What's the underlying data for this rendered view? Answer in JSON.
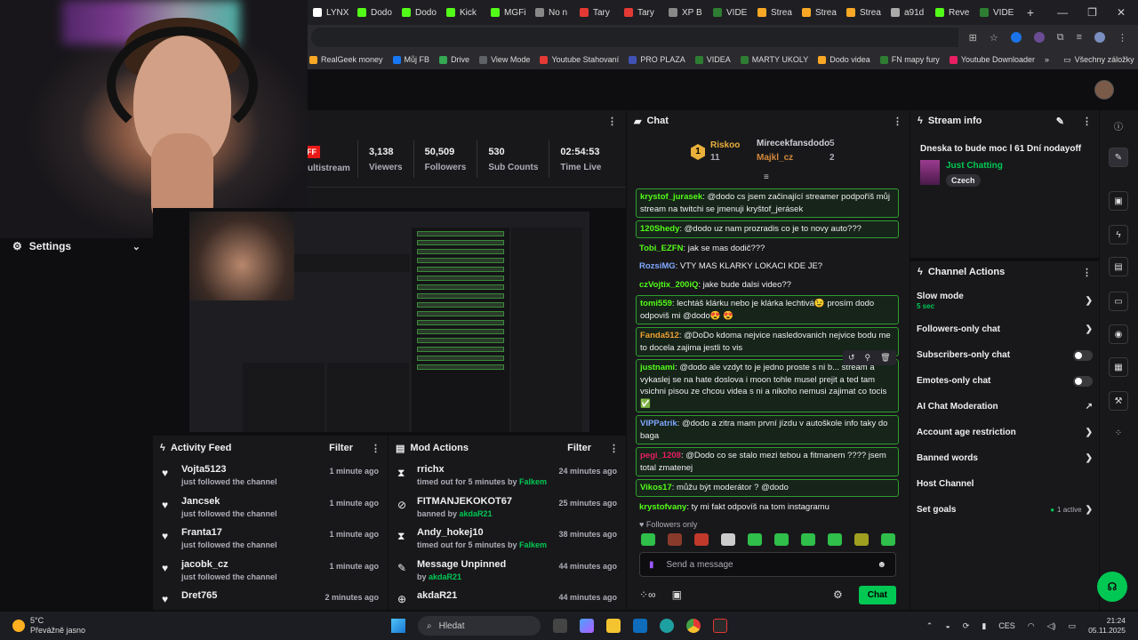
{
  "browser": {
    "tabs": [
      {
        "label": "LYNX",
        "color": "#ffffff"
      },
      {
        "label": "Dodo",
        "color": "#53fc18"
      },
      {
        "label": "Dodo",
        "color": "#53fc18"
      },
      {
        "label": "Kick",
        "color": "#53fc18"
      },
      {
        "label": "MGFi",
        "color": "#53fc18"
      },
      {
        "label": "No n",
        "color": "#888888"
      },
      {
        "label": "Tary",
        "color": "#e53935"
      },
      {
        "label": "Tary",
        "color": "#e53935"
      },
      {
        "label": "XP B",
        "color": "#888888"
      },
      {
        "label": "VIDE",
        "color": "#2e7d32"
      },
      {
        "label": "Strea",
        "color": "#f9a825"
      },
      {
        "label": "Strea",
        "color": "#f9a825"
      },
      {
        "label": "Strea",
        "color": "#f9a825"
      },
      {
        "label": "a91d",
        "color": "#aaaaaa"
      },
      {
        "label": "Reve",
        "color": "#53fc18"
      },
      {
        "label": "VIDE",
        "color": "#2e7d32"
      }
    ],
    "new_tab": "+",
    "bookmarks": [
      {
        "label": "RealGeek money",
        "color": "#f9a825"
      },
      {
        "label": "Můj FB",
        "color": "#1877f2"
      },
      {
        "label": "Drive",
        "color": "#34a853"
      },
      {
        "label": "View Mode",
        "color": "#5f6368"
      },
      {
        "label": "Youtube Stahovaní",
        "color": "#e53935"
      },
      {
        "label": "PRO PLAZA",
        "color": "#3f51b5"
      },
      {
        "label": "VIDEA",
        "color": "#2e7d32"
      },
      {
        "label": "MARTY UKOLY",
        "color": "#2e7d32"
      },
      {
        "label": "Dodo videa",
        "color": "#f9a825"
      },
      {
        "label": "FN mapy fury",
        "color": "#2e7d32"
      },
      {
        "label": "Youtube Downloader",
        "color": "#e91e63"
      }
    ],
    "more_bookmarks": "»",
    "all_bookmarks": "Všechny záložky"
  },
  "webcam_settings": {
    "label": "Settings"
  },
  "stats": {
    "off_badge": "OFF",
    "multistream": "ultistream",
    "items": [
      {
        "value": "3,138",
        "label": "Viewers"
      },
      {
        "value": "50,509",
        "label": "Followers"
      },
      {
        "value": "530",
        "label": "Sub Counts"
      },
      {
        "value": "02:54:53",
        "label": "Time Live"
      }
    ]
  },
  "activity_feed": {
    "title": "Activity Feed",
    "filter": "Filter",
    "items": [
      {
        "name": "Vojta5123",
        "sub": "just followed the channel",
        "time": "1 minute ago"
      },
      {
        "name": "Jancsek",
        "sub": "just followed the channel",
        "time": "1 minute ago"
      },
      {
        "name": "Franta17",
        "sub": "just followed the channel",
        "time": "1 minute ago"
      },
      {
        "name": "jacobk_cz",
        "sub": "just followed the channel",
        "time": "1 minute ago"
      },
      {
        "name": "Dret765",
        "sub": "",
        "time": "2 minutes ago"
      }
    ]
  },
  "mod_actions": {
    "title": "Mod Actions",
    "filter": "Filter",
    "items": [
      {
        "icon": "⧗",
        "name": "rrichx",
        "sub": "timed out for 5 minutes by",
        "by": "Falkem",
        "time": "24 minutes ago"
      },
      {
        "icon": "⊘",
        "name": "FITMANJEKOKOT67",
        "sub": "banned by",
        "by": "akdaR21",
        "time": "25 minutes ago"
      },
      {
        "icon": "⧗",
        "name": "Andy_hokej10",
        "sub": "timed out for 5 minutes by",
        "by": "Falkem",
        "time": "38 minutes ago"
      },
      {
        "icon": "✎",
        "name": "Message Unpinned",
        "sub": "by",
        "by": "akdaR21",
        "time": "44 minutes ago"
      },
      {
        "icon": "⊕",
        "name": "akdaR21",
        "sub": "",
        "by": "",
        "time": "44 minutes ago"
      }
    ]
  },
  "chat": {
    "title": "Chat",
    "leaderboard": {
      "rank1_badge": "1",
      "rank1_name": "Riskoo",
      "rank1_count": "11",
      "rank2_name": "Mirecekfansdodo",
      "rank2_count": "5",
      "rank3_name": "Majkl_cz",
      "rank3_count": "2"
    },
    "messages": [
      {
        "user": "krystof_jurasek",
        "color": "#53fc18",
        "text": "@dodo cs jsem začinající streamer podpoříš můj stream na twitchi se jmenuji kryštof_jerásek",
        "highlight": true
      },
      {
        "user": "120Shedy",
        "color": "#53fc18",
        "text": "@dodo uz nam prozradis co je to novy auto???",
        "highlight": true
      },
      {
        "user": "Tobi_EZFN",
        "color": "#53fc18",
        "text": "jak se mas dodič???",
        "highlight": false
      },
      {
        "user": "RozsiMG",
        "color": "#7fa8ff",
        "text": "VTY MAS KLARKY LOKACI KDE JE?",
        "highlight": false
      },
      {
        "user": "czVojtix_200iQ",
        "color": "#53fc18",
        "text": "jake bude dalsi video??",
        "highlight": false
      },
      {
        "user": "tomi559",
        "color": "#53fc18",
        "text": "lechtáš klárku nebo je klárka lechtivá😉 prosím dodo odpoviš mi @dodo😍 😍",
        "highlight": true
      },
      {
        "user": "Fanda512",
        "color": "#f0a030",
        "text": "@DoDo kdoma nejvice nasledovanich nejvice bodu me to docela zajima jestli to vis",
        "highlight": true
      },
      {
        "user": "justnami",
        "color": "#53fc18",
        "text": "@dodo ale vzdyt to je jedno proste s ni b... stream a vykaslej se na hate doslova i moon tohle musel prejit a ted tam vsichni pisou ze chcou videa s ni a nikoho nemusi zajimat co tocis ✅",
        "highlight": true
      },
      {
        "user": "VIPPatrik",
        "color": "#7fa8ff",
        "text": "@dodo a zitra mam první jízdu v autoškole info taky do baga",
        "highlight": true
      },
      {
        "user": "pegi_1208",
        "color": "#e91e63",
        "text": "@Dodo co se stalo mezi tebou a fitmanem ???? jsem total zmatenej",
        "highlight": true
      },
      {
        "user": "Vikos17",
        "color": "#53fc18",
        "text": "můžu být moderátor ? @dodo",
        "highlight": true
      },
      {
        "user": "krystofvany",
        "color": "#53fc18",
        "text": "ty mi fakt odpovíš na tom instagramu",
        "highlight": false
      }
    ],
    "followers_only": "Followers only",
    "input_placeholder": "Send a message",
    "send_label": "Chat"
  },
  "stream_info": {
    "title": "Stream info",
    "stream_title": "Dneska to bude moc l 61 Dní nodayoff",
    "category": "Just Chatting",
    "language": "Czech"
  },
  "channel_actions": {
    "title": "Channel Actions",
    "items": [
      {
        "label": "Slow mode",
        "sub": "5 sec",
        "control": "chevron"
      },
      {
        "label": "Followers-only chat",
        "sub": "",
        "control": "chevron"
      },
      {
        "label": "Subscribers-only chat",
        "sub": "",
        "control": "toggle"
      },
      {
        "label": "Emotes-only chat",
        "sub": "",
        "control": "toggle"
      },
      {
        "label": "AI Chat Moderation",
        "sub": "",
        "control": "external"
      },
      {
        "label": "Account age restriction",
        "sub": "",
        "control": "chevron"
      },
      {
        "label": "Banned words",
        "sub": "",
        "control": "chevron"
      },
      {
        "label": "Host Channel",
        "sub": "",
        "control": "none"
      },
      {
        "label": "Set goals",
        "sub": "",
        "control": "active",
        "active_text": "1 active"
      }
    ]
  },
  "taskbar": {
    "temp": "5°C",
    "weather": "Převážně jasno",
    "search": "Hledat",
    "lang": "CES",
    "time": "21:24",
    "date": "05.11.2025"
  }
}
